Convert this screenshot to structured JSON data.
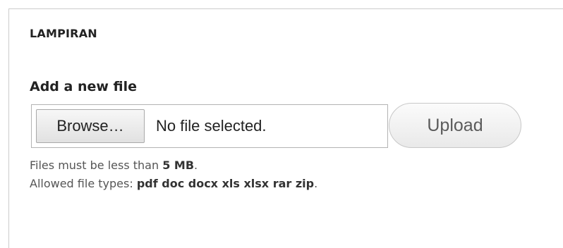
{
  "fieldset": {
    "legend": "LAMPIRAN"
  },
  "file_field": {
    "label": "Add a new file",
    "browse_label": "Browse…",
    "status_text": "No file selected.",
    "upload_label": "Upload"
  },
  "description": {
    "size_prefix": "Files must be less than ",
    "size_value": "5 MB",
    "size_suffix": ".",
    "types_prefix": "Allowed file types: ",
    "types_value": "pdf doc docx xls xlsx rar zip",
    "types_suffix": "."
  }
}
